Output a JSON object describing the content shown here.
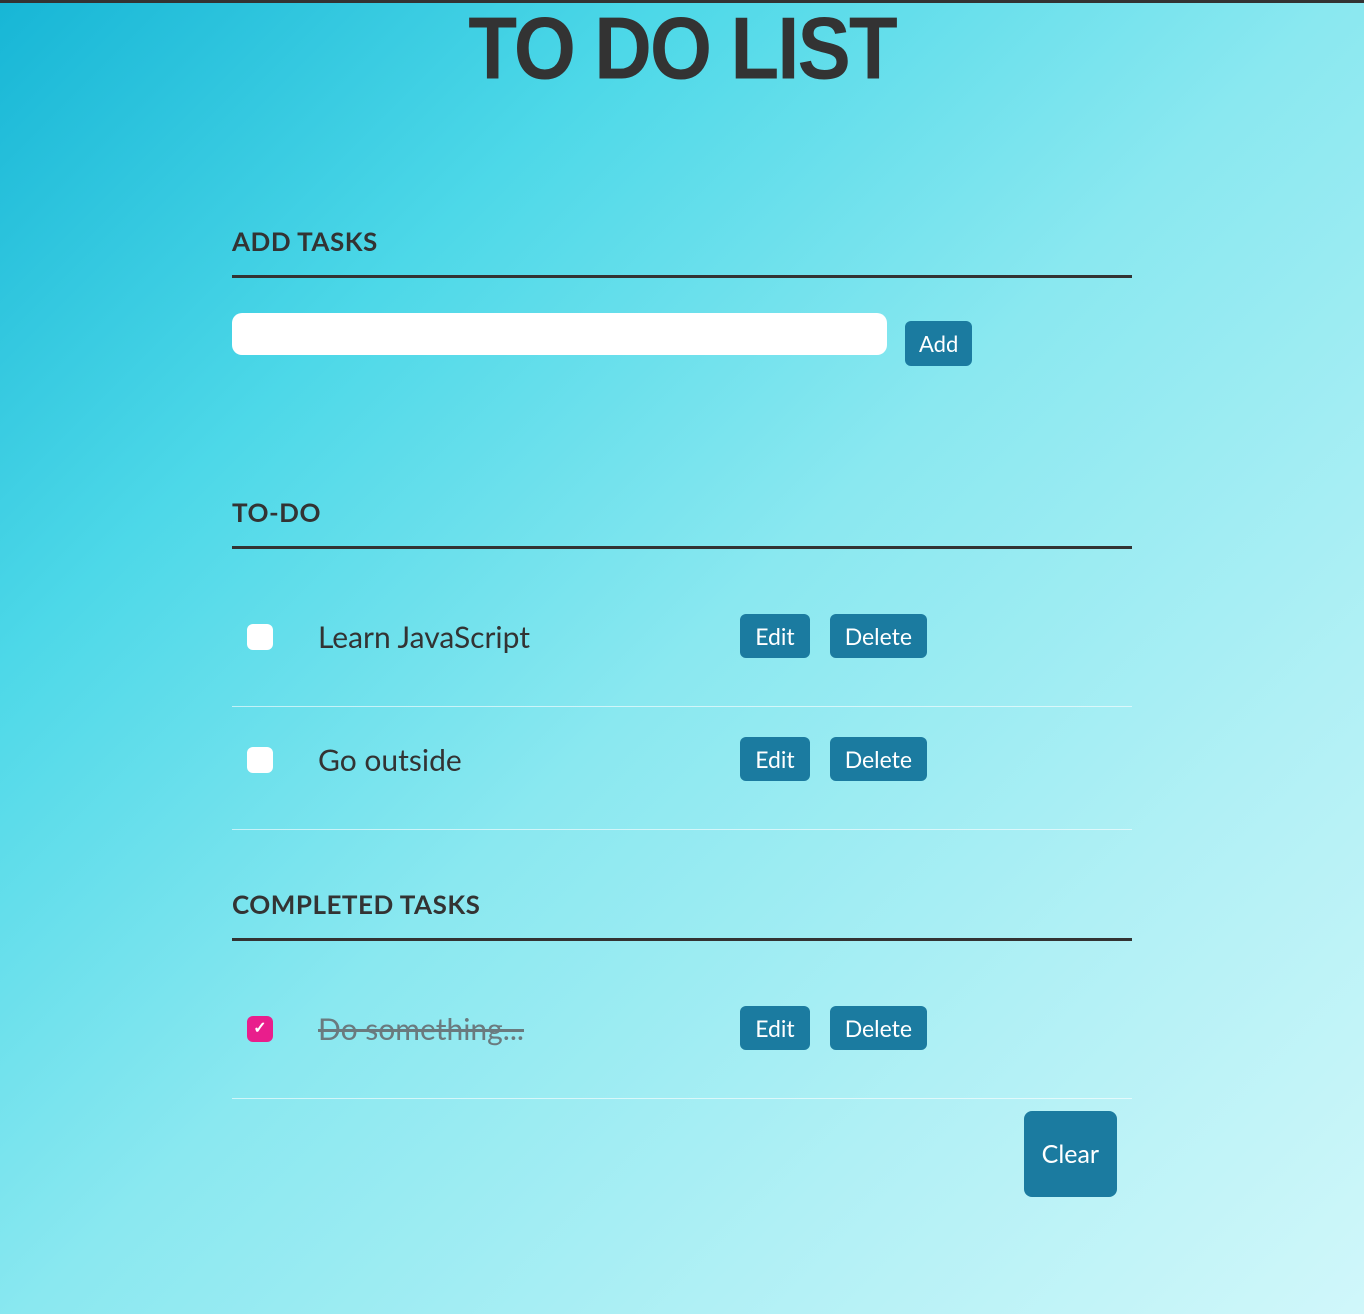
{
  "title": "TO DO LIST",
  "sections": {
    "add": {
      "header": "ADD TASKS",
      "input_value": "",
      "add_button": "Add"
    },
    "todo": {
      "header": "TO-DO",
      "items": [
        {
          "label": "Learn JavaScript",
          "checked": false,
          "edit": "Edit",
          "delete": "Delete"
        },
        {
          "label": "Go outside",
          "checked": false,
          "edit": "Edit",
          "delete": "Delete"
        }
      ]
    },
    "completed": {
      "header": "COMPLETED TASKS",
      "items": [
        {
          "label": "Do something...",
          "checked": true,
          "edit": "Edit",
          "delete": "Delete"
        }
      ],
      "clear_button": "Clear"
    }
  }
}
